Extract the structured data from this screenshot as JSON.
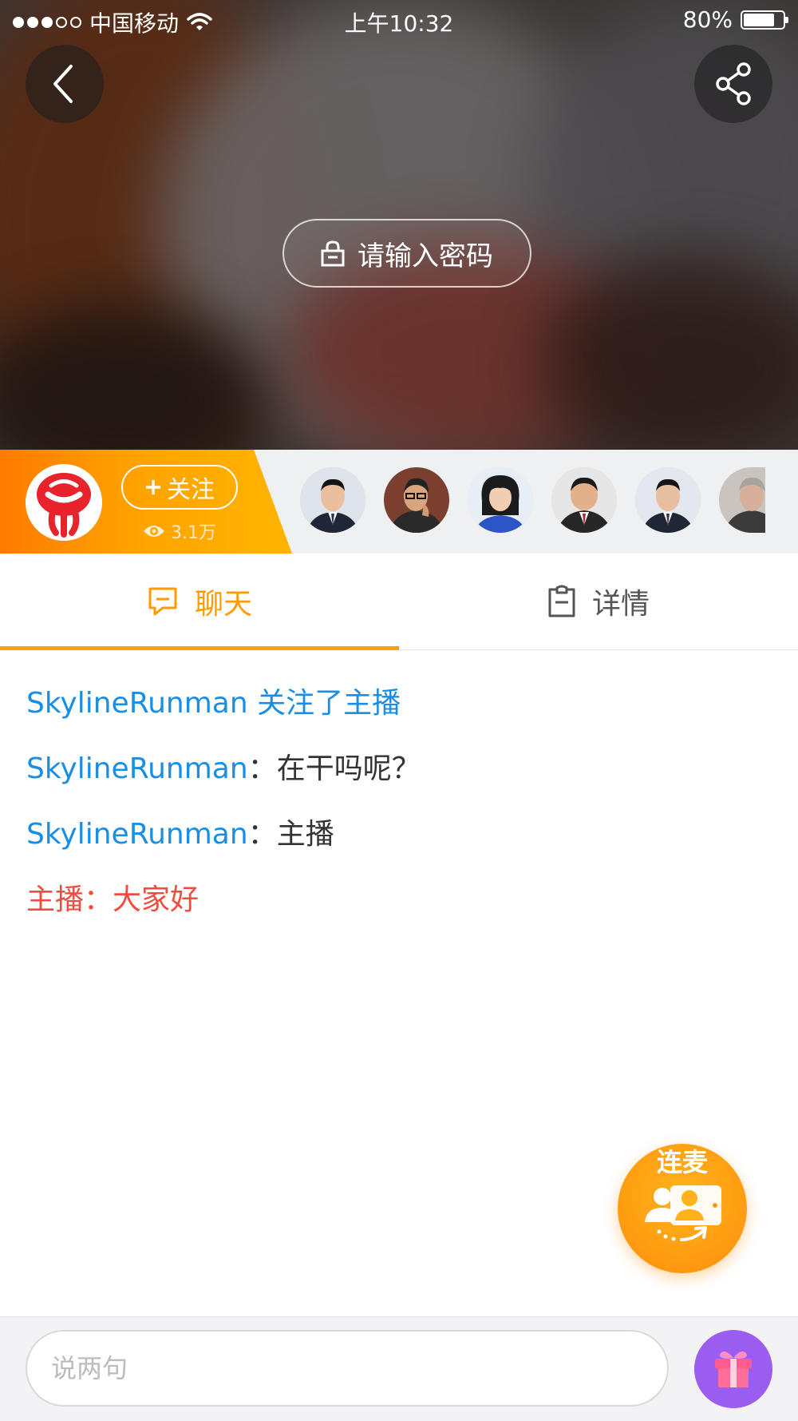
{
  "status_bar": {
    "carrier": "中国移动",
    "time": "上午10:32",
    "battery": "80%",
    "battery_level": 0.8
  },
  "video": {
    "password_prompt": "请输入密码"
  },
  "anchor": {
    "follow_label": "关注",
    "views": "3.1万",
    "viewer_count_visible": 6
  },
  "tabs": [
    {
      "label": "聊天",
      "active": true
    },
    {
      "label": "详情",
      "active": false
    }
  ],
  "chat": {
    "messages": [
      {
        "user": "SkylineRunman",
        "sep": " ",
        "text": "关注了主播",
        "type": "system"
      },
      {
        "user": "SkylineRunman",
        "sep": "：",
        "text": "在干吗呢？",
        "type": "user"
      },
      {
        "user": "SkylineRunman",
        "sep": "：",
        "text": "主播",
        "type": "user"
      },
      {
        "user": "主播",
        "sep": "：",
        "text": "大家好",
        "type": "host"
      }
    ]
  },
  "link_mic": {
    "label": "连麦"
  },
  "input": {
    "placeholder": "说两句"
  },
  "colors": {
    "accent_orange": "#ffa200",
    "username_blue": "#1a8ee3",
    "host_red": "#f24b40",
    "gift_purple": "#9b5cf0"
  },
  "icons": [
    "back-icon",
    "share-icon",
    "lock-icon",
    "plus-icon",
    "eye-icon",
    "chat-bubble-icon",
    "clipboard-icon",
    "link-mic-icon",
    "gift-icon",
    "wifi-icon",
    "battery-icon"
  ]
}
